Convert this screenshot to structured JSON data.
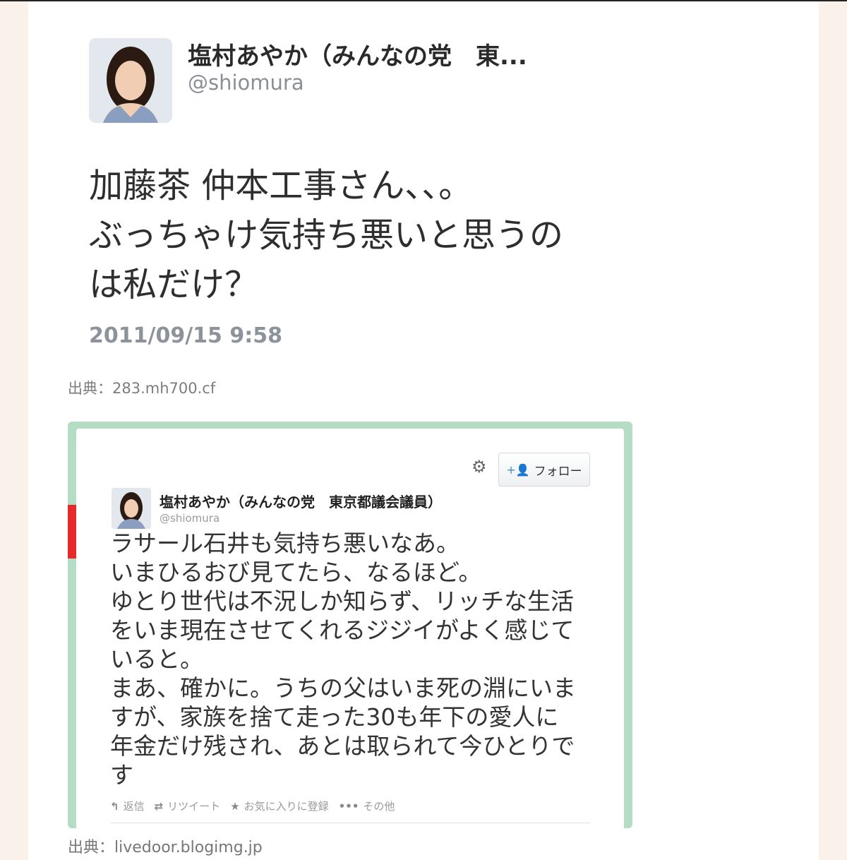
{
  "profile": {
    "name": "塩村あやか（みんなの党　東...",
    "handle": "@shiomura"
  },
  "tweet": {
    "lines": [
      "加藤茶 仲本工事さん、、。",
      "ぶっちゃけ気持ち悪いと思うの",
      "は私だけ？"
    ],
    "date": "2011/09/15 9:58"
  },
  "source1": "出典：283.mh700.cf",
  "embedded": {
    "follow_label": "フォロー",
    "name": "塩村あやか（みんなの党　東京都議会議員）",
    "handle": "@shiomura",
    "lines": [
      "ラサール石井も気持ち悪いなあ。",
      "いまひるおび見てたら、なるほど。",
      "ゆとり世代は不況しか知らず、リッチな生活",
      "をいま現在させてくれるジジイがよく感じて",
      "いると。",
      "まあ、確かに。うちの父はいま死の淵にいま",
      "すが、家族を捨て走った30も年下の愛人に",
      "年金だけ残され、あとは取られて今ひとりで",
      "す"
    ],
    "actions": {
      "reply": "返信",
      "retweet": "リツイート",
      "favorite": "お気に入りに登録",
      "more": "その他"
    }
  },
  "source2": "出典：livedoor.blogimg.jp"
}
